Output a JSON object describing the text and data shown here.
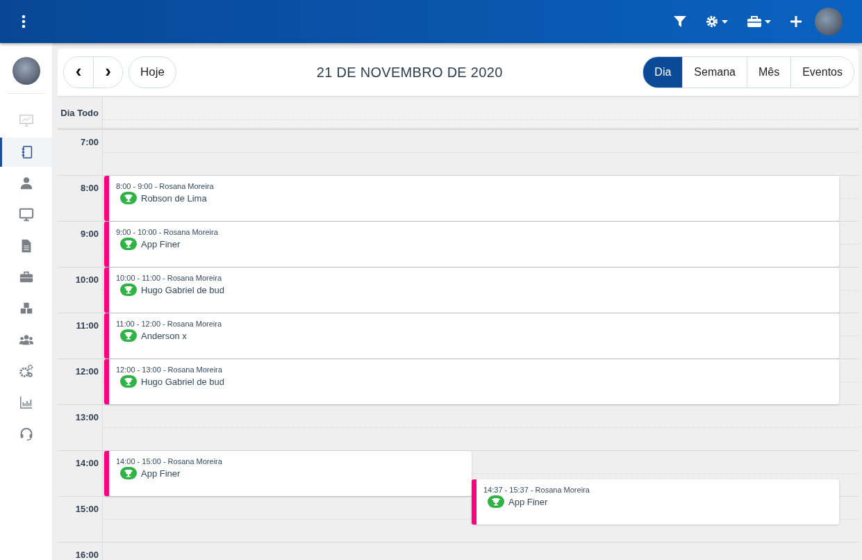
{
  "toolbar": {
    "nav_prev": "‹",
    "nav_next": "›",
    "today_button": "Hoje",
    "date_title": "21 DE NOVEMBRO DE 2020",
    "views": [
      {
        "label": "Dia",
        "selected": true
      },
      {
        "label": "Semana",
        "selected": false
      },
      {
        "label": "Mês",
        "selected": false
      },
      {
        "label": "Eventos",
        "selected": false
      }
    ]
  },
  "sidebar": {
    "items": [
      {
        "selected": false
      },
      {
        "selected": true
      },
      {
        "selected": false
      },
      {
        "selected": false
      },
      {
        "selected": false
      },
      {
        "selected": false
      },
      {
        "selected": false
      },
      {
        "selected": false
      },
      {
        "selected": false
      },
      {
        "selected": false
      },
      {
        "selected": false
      }
    ]
  },
  "calendar": {
    "all_day_label": "Dia Todo",
    "hours": [
      {
        "label": "7:00"
      },
      {
        "label": "8:00",
        "events": [
          {
            "time": "8:00 - 9:00 - Rosana Moreira",
            "title": "Robson de Lima",
            "color": "#ff0080"
          }
        ]
      },
      {
        "label": "9:00",
        "events": [
          {
            "time": "9:00 - 10:00 - Rosana Moreira",
            "title": "App Finer",
            "color": "#ff0080"
          }
        ]
      },
      {
        "label": "10:00",
        "events": [
          {
            "time": "10:00 - 11:00 - Rosana Moreira",
            "title": "Hugo Gabriel de bud",
            "color": "#ff0080"
          }
        ]
      },
      {
        "label": "11:00",
        "events": [
          {
            "time": "11:00 - 12:00 - Rosana Moreira",
            "title": "Anderson x",
            "color": "#ff0080"
          }
        ]
      },
      {
        "label": "12:00",
        "events": [
          {
            "time": "12:00 - 13:00 - Rosana Moreira",
            "title": "Hugo Gabriel de bud",
            "color": "#ff0080"
          }
        ]
      },
      {
        "label": "13:00"
      },
      {
        "label": "14:00",
        "events": [
          {
            "time": "14:00 - 15:00 - Rosana Moreira",
            "title": "App Finer",
            "color": "#ff0080"
          },
          {
            "time": "14:37 - 15:37 - Rosana Moreira",
            "title": "App Finer",
            "color": "#ff0080"
          }
        ]
      },
      {
        "label": "15:00"
      },
      {
        "label": "16:00"
      }
    ]
  }
}
